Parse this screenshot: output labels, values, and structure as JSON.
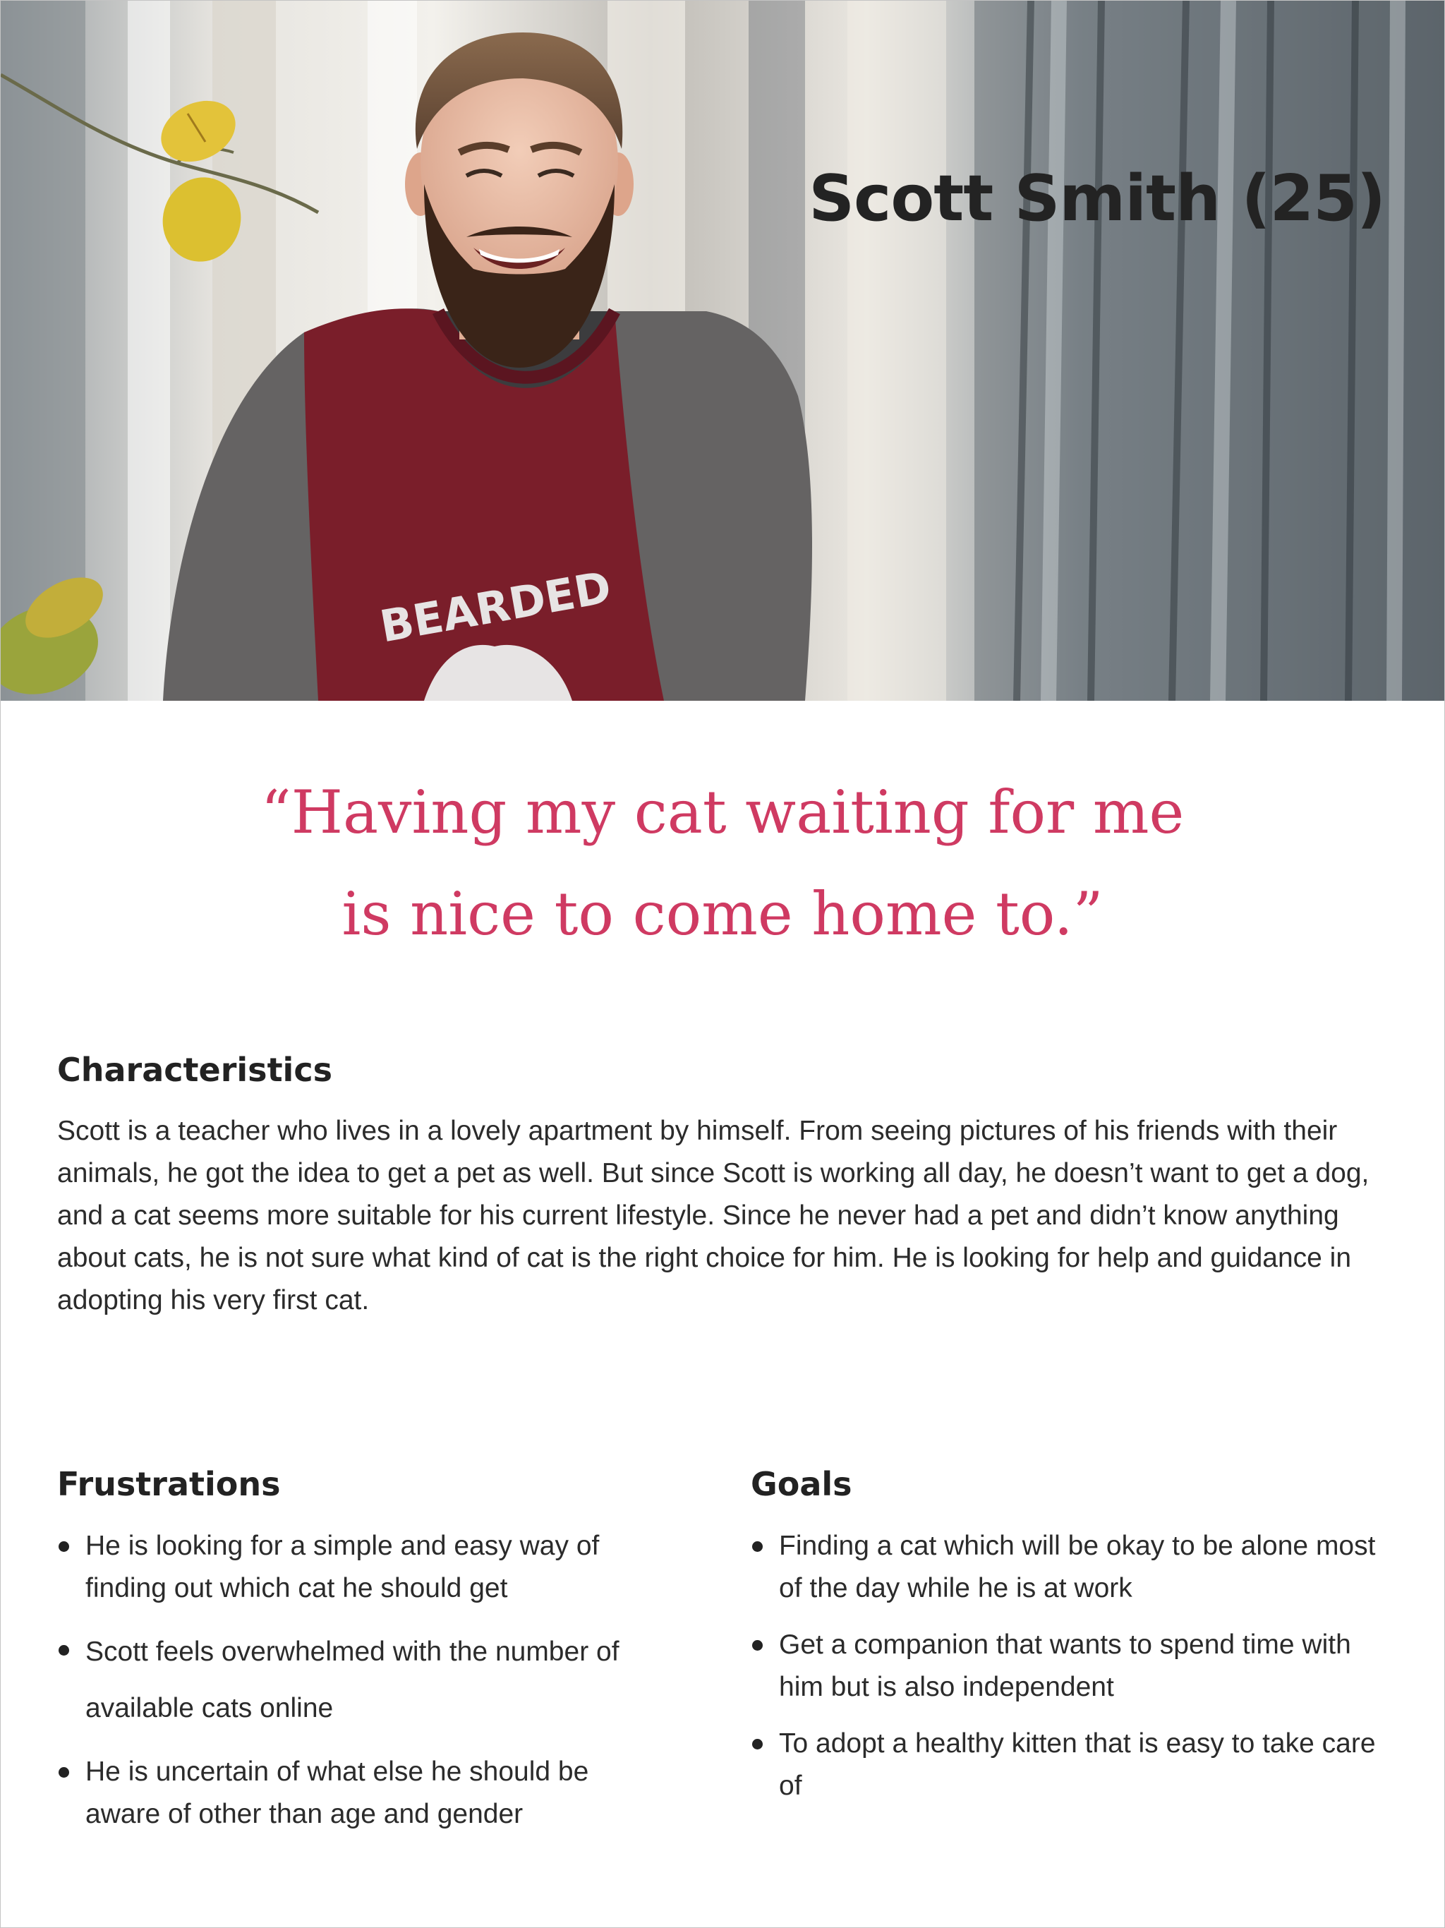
{
  "persona": {
    "name": "Scott Smith (25)",
    "shirt_print": "BEARDED"
  },
  "quote": {
    "line1": "“Having my cat waiting for me",
    "line2": "is nice to come home to.”"
  },
  "characteristics": {
    "title": "Characteristics",
    "text": "Scott is a teacher who lives in a lovely apartment by himself. From seeing pictures of his friends with their animals, he got the idea to get a pet as well. But since Scott is working all day, he doesn’t want to get a dog, and a cat seems more suitable for his current lifestyle. Since he never had a pet and didn’t know anything about cats, he is not sure what kind of cat is the right choice for him. He is looking for help and guidance in adopting his very first cat."
  },
  "frustrations": {
    "title": "Frustrations",
    "items": [
      "He is looking for a simple and easy way of finding out which cat he should get",
      "Scott feels overwhelmed with the number of available cats online",
      "He is uncertain of what else he should be aware of other than age and gender"
    ]
  },
  "goals": {
    "title": "Goals",
    "items": [
      "Finding a cat which will be okay to be alone most of the day while he is at work",
      "Get a companion that wants to spend time with him but is also independent",
      "To adopt a healthy kitten that is easy to take care of"
    ]
  },
  "colors": {
    "quote": "#cf3a62",
    "heading": "#222222",
    "body": "#2b2b2b",
    "sweater_body": "#7a1e2a",
    "sweater_sleeves": "#646262"
  }
}
